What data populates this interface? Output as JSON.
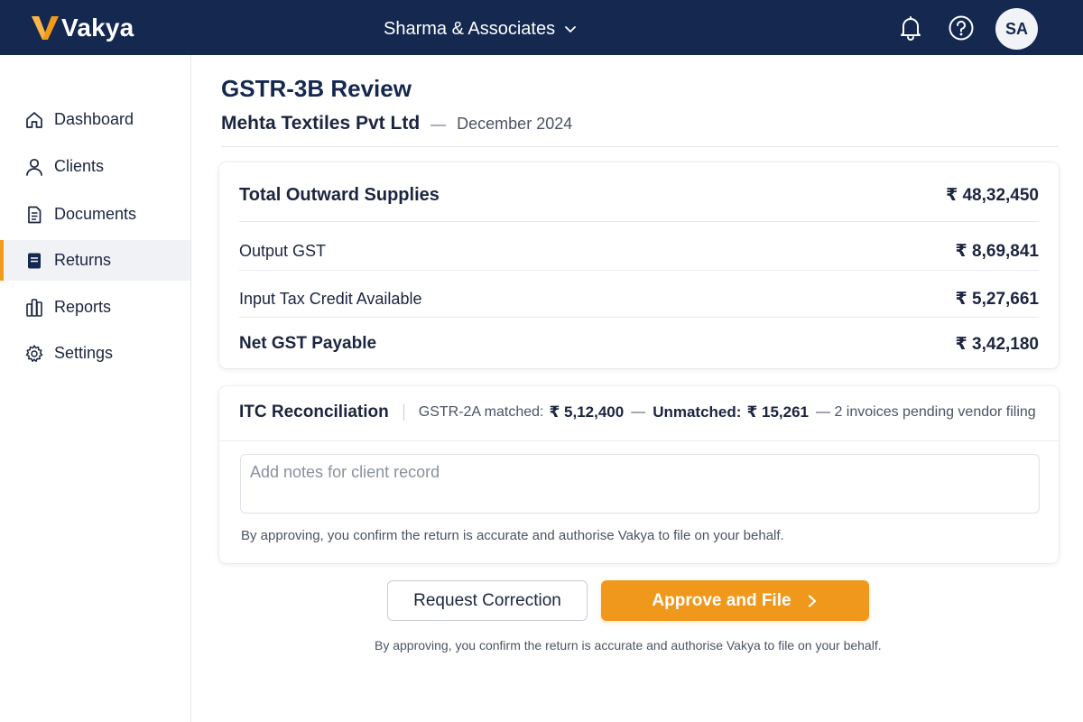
{
  "app": {
    "name": "Vakya",
    "brand_color": "#142850",
    "accent_color": "#f0981b"
  },
  "header": {
    "organization": "Sharma & Associates",
    "icons": [
      "bell-icon",
      "help-icon",
      "chevron-down-icon"
    ],
    "avatar_initials": "SA"
  },
  "sidebar": {
    "items": [
      {
        "label": "Dashboard",
        "icon": "home-icon",
        "active": false
      },
      {
        "label": "Clients",
        "icon": "user-icon",
        "active": false
      },
      {
        "label": "Documents",
        "icon": "document-icon",
        "active": false
      },
      {
        "label": "Returns",
        "icon": "return-form-icon",
        "active": true
      },
      {
        "label": "Reports",
        "icon": "reports-icon",
        "active": false
      },
      {
        "label": "Settings",
        "icon": "gear-icon",
        "active": false
      }
    ]
  },
  "page": {
    "title": "GSTR-3B Review",
    "client": "Mehta Textiles Pvt Ltd",
    "separator": "—",
    "period": "December 2024"
  },
  "summary": {
    "rows": [
      {
        "label": "Total Outward Supplies",
        "value": "₹ 48,32,450"
      },
      {
        "label": "Output GST",
        "value": "₹ 8,69,841"
      },
      {
        "label": "Input Tax Credit Available",
        "value": "₹ 5,27,661"
      },
      {
        "label": "Net GST Payable",
        "value": "₹ 3,42,180"
      }
    ]
  },
  "itc": {
    "title": "ITC Reconciliation",
    "matched_label": "GSTR-2A matched:",
    "matched_value": "₹ 5,12,400",
    "dash": "—",
    "unmatched_label": "Unmatched:",
    "unmatched_value": "₹ 15,261",
    "pending_note": "— 2 invoices pending vendor filing",
    "notes_placeholder": "Add notes for client record",
    "notes_value": "",
    "consent": "By approving, you confirm the return is accurate and authorise Vakya to file on your behalf."
  },
  "actions": {
    "request_correction": "Request Correction",
    "approve_and_file": "Approve and File",
    "consent": "By approving, you confirm the return is accurate and authorise Vakya to file on your behalf."
  }
}
